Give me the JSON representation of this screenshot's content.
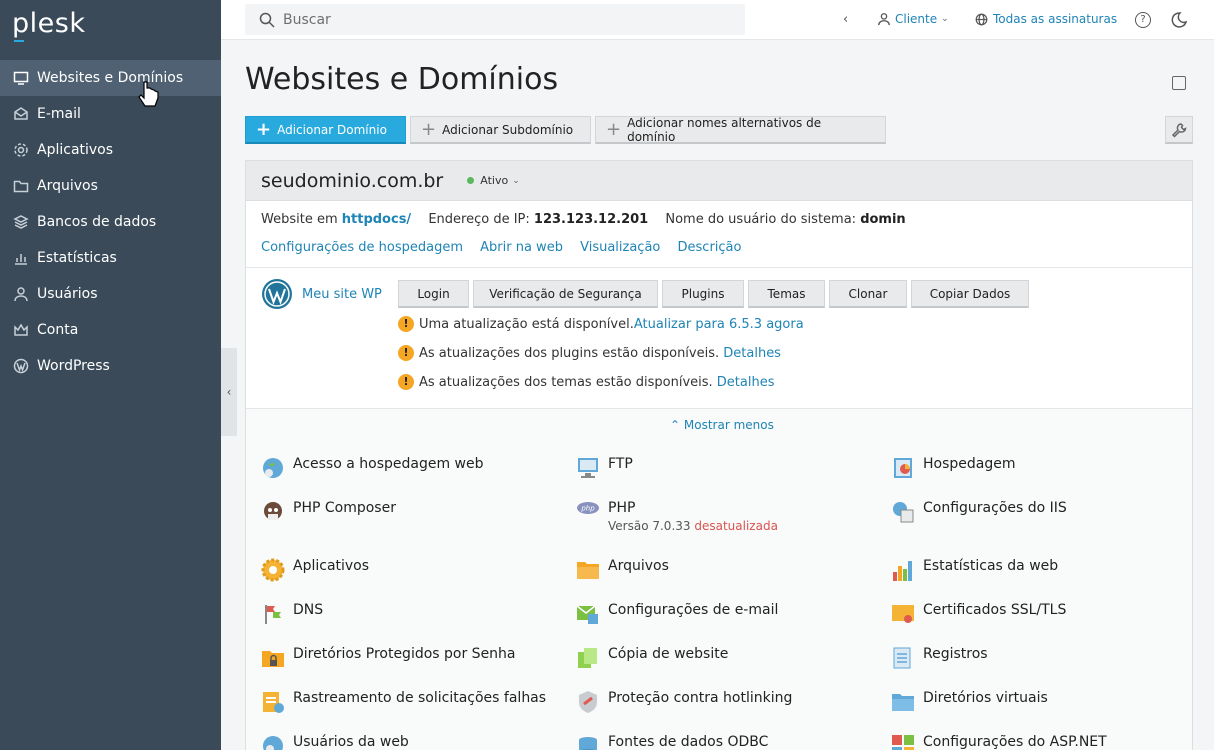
{
  "app": {
    "logo": "plesk"
  },
  "sidebar": {
    "items": [
      {
        "label": "Websites e Domínios",
        "icon": "monitor-icon",
        "active": true
      },
      {
        "label": "E-mail",
        "icon": "mail-icon"
      },
      {
        "label": "Aplicativos",
        "icon": "gear-icon"
      },
      {
        "label": "Arquivos",
        "icon": "folder-icon"
      },
      {
        "label": "Bancos de dados",
        "icon": "database-icon"
      },
      {
        "label": "Estatísticas",
        "icon": "stats-icon"
      },
      {
        "label": "Usuários",
        "icon": "user-icon"
      },
      {
        "label": "Conta",
        "icon": "crown-icon"
      },
      {
        "label": "WordPress",
        "icon": "wordpress-icon"
      }
    ]
  },
  "topbar": {
    "search_placeholder": "Buscar",
    "client_label": "Cliente",
    "subscriptions_label": "Todas as assinaturas"
  },
  "page": {
    "title": "Websites e Domínios"
  },
  "toolbar": {
    "add_domain": "Adicionar Domínio",
    "add_subdomain": "Adicionar Subdomínio",
    "add_aliases": "Adicionar nomes alternativos de domínio"
  },
  "domain": {
    "name": "seudominio.com.br",
    "status": "Ativo",
    "status_color": "#5cb85c",
    "website_label": "Website em",
    "website_path": "httpdocs/",
    "ip_label": "Endereço de IP:",
    "ip": "123.123.12.201",
    "user_label": "Nome do usuário do sistema:",
    "user": "domin",
    "links": [
      "Configurações de hospedagem",
      "Abrir na web",
      "Visualização",
      "Descrição"
    ]
  },
  "wordpress": {
    "site_name": "Meu site WP",
    "buttons": [
      "Login",
      "Verificação de Segurança",
      "Plugins",
      "Temas",
      "Clonar",
      "Copiar Dados"
    ],
    "notices": [
      {
        "text": "Uma atualização está disponível.",
        "link": "Atualizar para 6.5.3 agora"
      },
      {
        "text": "As atualizações dos plugins estão disponíveis. ",
        "link": "Detalhes"
      },
      {
        "text": "As atualizações dos temas estão disponíveis. ",
        "link": "Detalhes"
      }
    ],
    "show_less": "Mostrar menos"
  },
  "tools": {
    "col1": [
      "Acesso a hospedagem web",
      "PHP Composer",
      "Aplicativos",
      "DNS",
      "Diretórios Protegidos por Senha",
      "Rastreamento de solicitações falhas",
      "Usuários da web"
    ],
    "col2": [
      "FTP",
      "PHP",
      "Arquivos",
      "Configurações de e-mail",
      "Cópia de website",
      "Proteção contra hotlinking",
      "Fontes de dados ODBC"
    ],
    "col3": [
      "Hospedagem",
      "Configurações do IIS",
      "Estatísticas da web",
      "Certificados SSL/TLS",
      "Registros",
      "Diretórios virtuais",
      "Configurações do ASP.NET"
    ],
    "php_version": "Versão 7.0.33",
    "php_outdated": "desatualizada"
  },
  "colors": {
    "sidebar_bg": "#3a4a59",
    "accent": "#28aade",
    "link": "#1f84b6",
    "warning": "#f5a623"
  }
}
